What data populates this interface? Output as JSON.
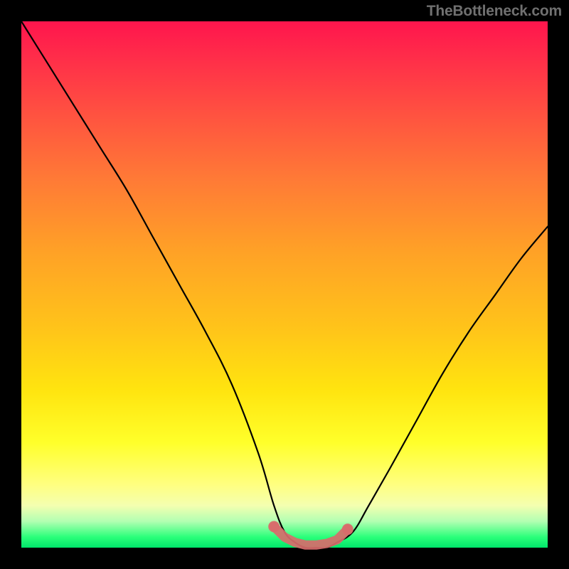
{
  "watermark": "TheBottleneck.com",
  "chart_data": {
    "type": "line",
    "title": "",
    "xlabel": "",
    "ylabel": "",
    "xlim": [
      0,
      100
    ],
    "ylim": [
      0,
      100
    ],
    "grid": false,
    "series": [
      {
        "name": "bottleneck-curve",
        "color": "#000000",
        "x": [
          0,
          5,
          10,
          15,
          20,
          25,
          30,
          35,
          40,
          45,
          48,
          50,
          52,
          54,
          56,
          58,
          60,
          63,
          66,
          70,
          75,
          80,
          85,
          90,
          95,
          100
        ],
        "y": [
          100,
          92,
          84,
          76,
          68,
          59,
          50,
          41,
          31,
          18,
          8,
          3,
          1,
          0,
          0,
          0,
          1,
          3,
          8,
          15,
          24,
          33,
          41,
          48,
          55,
          61
        ]
      },
      {
        "name": "optimal-marker",
        "type": "scatter",
        "color": "#d86b6b",
        "x": [
          48,
          50,
          52,
          54,
          56,
          58,
          60,
          62
        ],
        "y": [
          4,
          2,
          1,
          0.5,
          0.5,
          0.8,
          1.5,
          3.5
        ]
      }
    ],
    "background_gradient": {
      "top": "#ff154d",
      "mid": "#ffd21a",
      "bottom": "#00e56a"
    }
  }
}
